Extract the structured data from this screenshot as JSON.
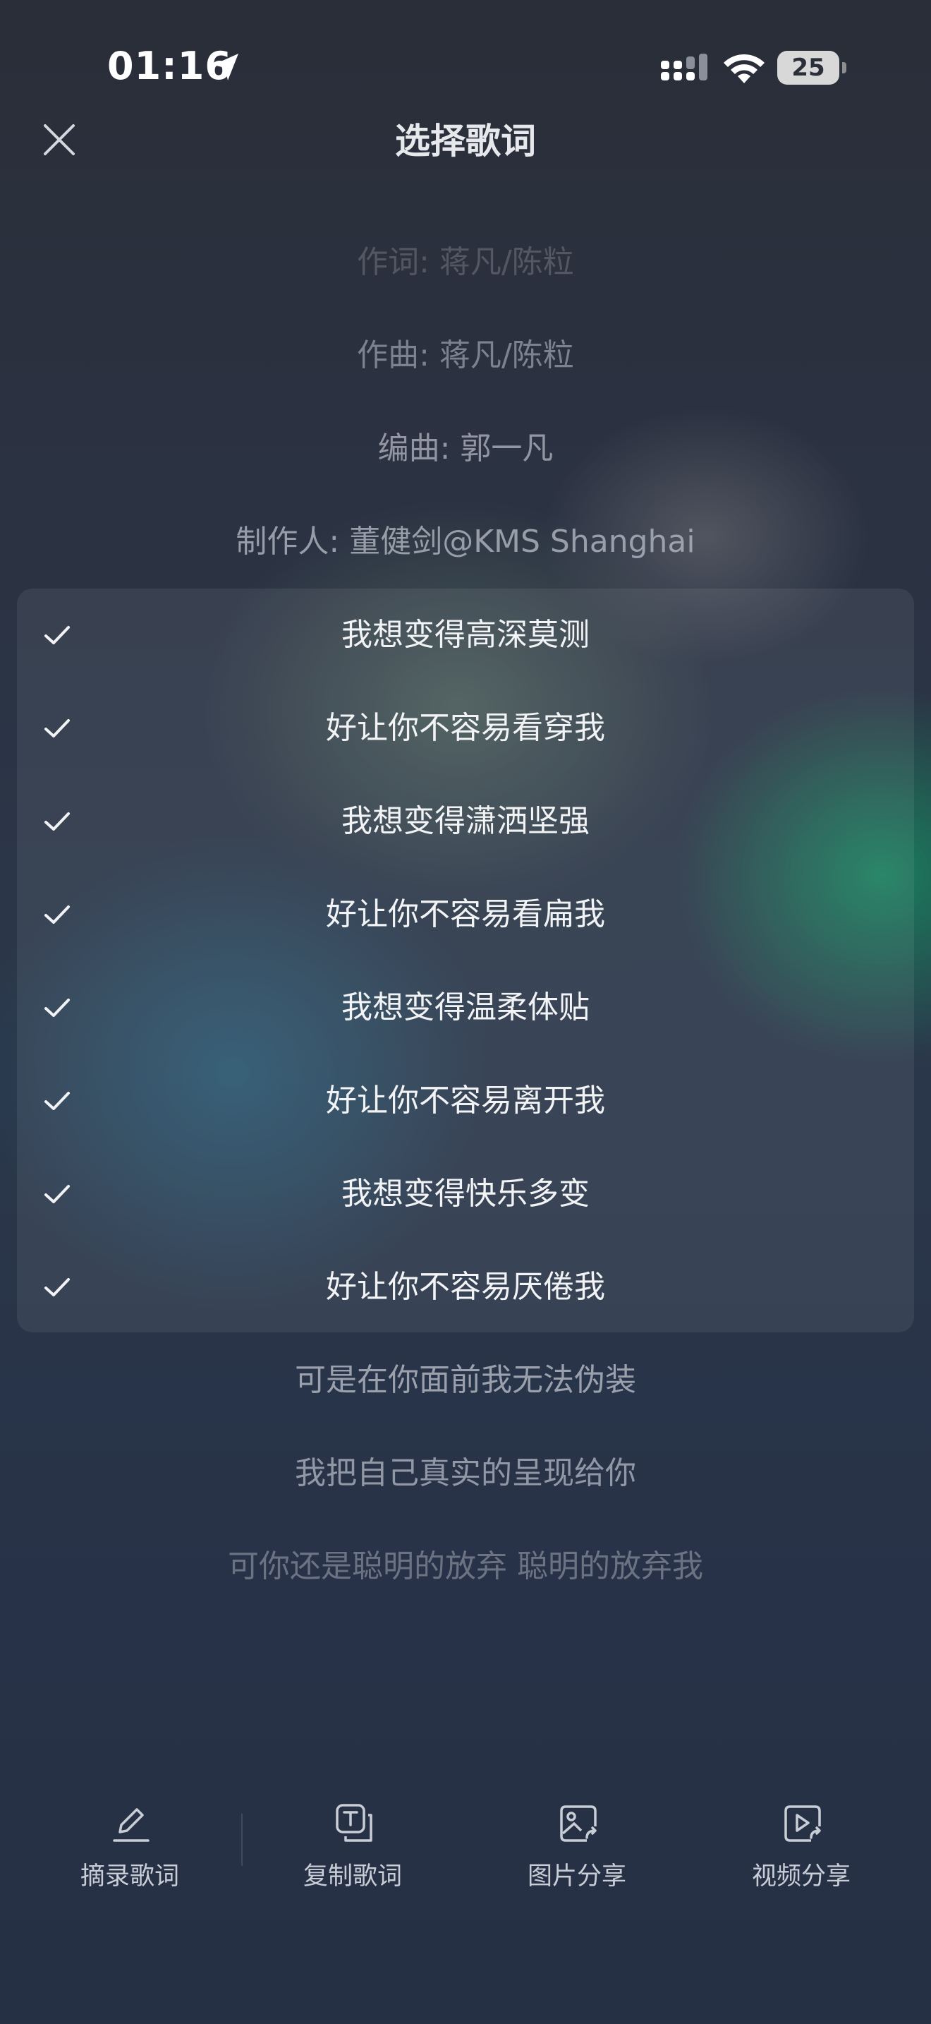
{
  "status_bar": {
    "time": "01:16",
    "battery": "25"
  },
  "header": {
    "title": "选择歌词"
  },
  "credits": [
    {
      "text": "作词: 蒋凡/陈粒"
    },
    {
      "text": "作曲: 蒋凡/陈粒"
    },
    {
      "text": "编曲: 郭一凡"
    },
    {
      "text": "制作人: 董健剑@KMS Shanghai"
    }
  ],
  "selected_lines": [
    {
      "text": "我想变得高深莫测",
      "checked": true
    },
    {
      "text": "好让你不容易看穿我",
      "checked": true
    },
    {
      "text": "我想变得潇洒坚强",
      "checked": true
    },
    {
      "text": "好让你不容易看扁我",
      "checked": true
    },
    {
      "text": "我想变得温柔体贴",
      "checked": true
    },
    {
      "text": "好让你不容易离开我",
      "checked": true
    },
    {
      "text": "我想变得快乐多变",
      "checked": true
    },
    {
      "text": "好让你不容易厌倦我",
      "checked": true
    }
  ],
  "following_lines": [
    {
      "text": "可是在你面前我无法伪装"
    },
    {
      "text": "我把自己真实的呈现给你"
    },
    {
      "text": "可你还是聪明的放弃 聪明的放弃我"
    }
  ],
  "toolbar": [
    {
      "label": "摘录歌词",
      "icon": "pencil-icon"
    },
    {
      "label": "复制歌词",
      "icon": "copy-text-icon"
    },
    {
      "label": "图片分享",
      "icon": "image-share-icon"
    },
    {
      "label": "视频分享",
      "icon": "video-share-icon"
    }
  ]
}
